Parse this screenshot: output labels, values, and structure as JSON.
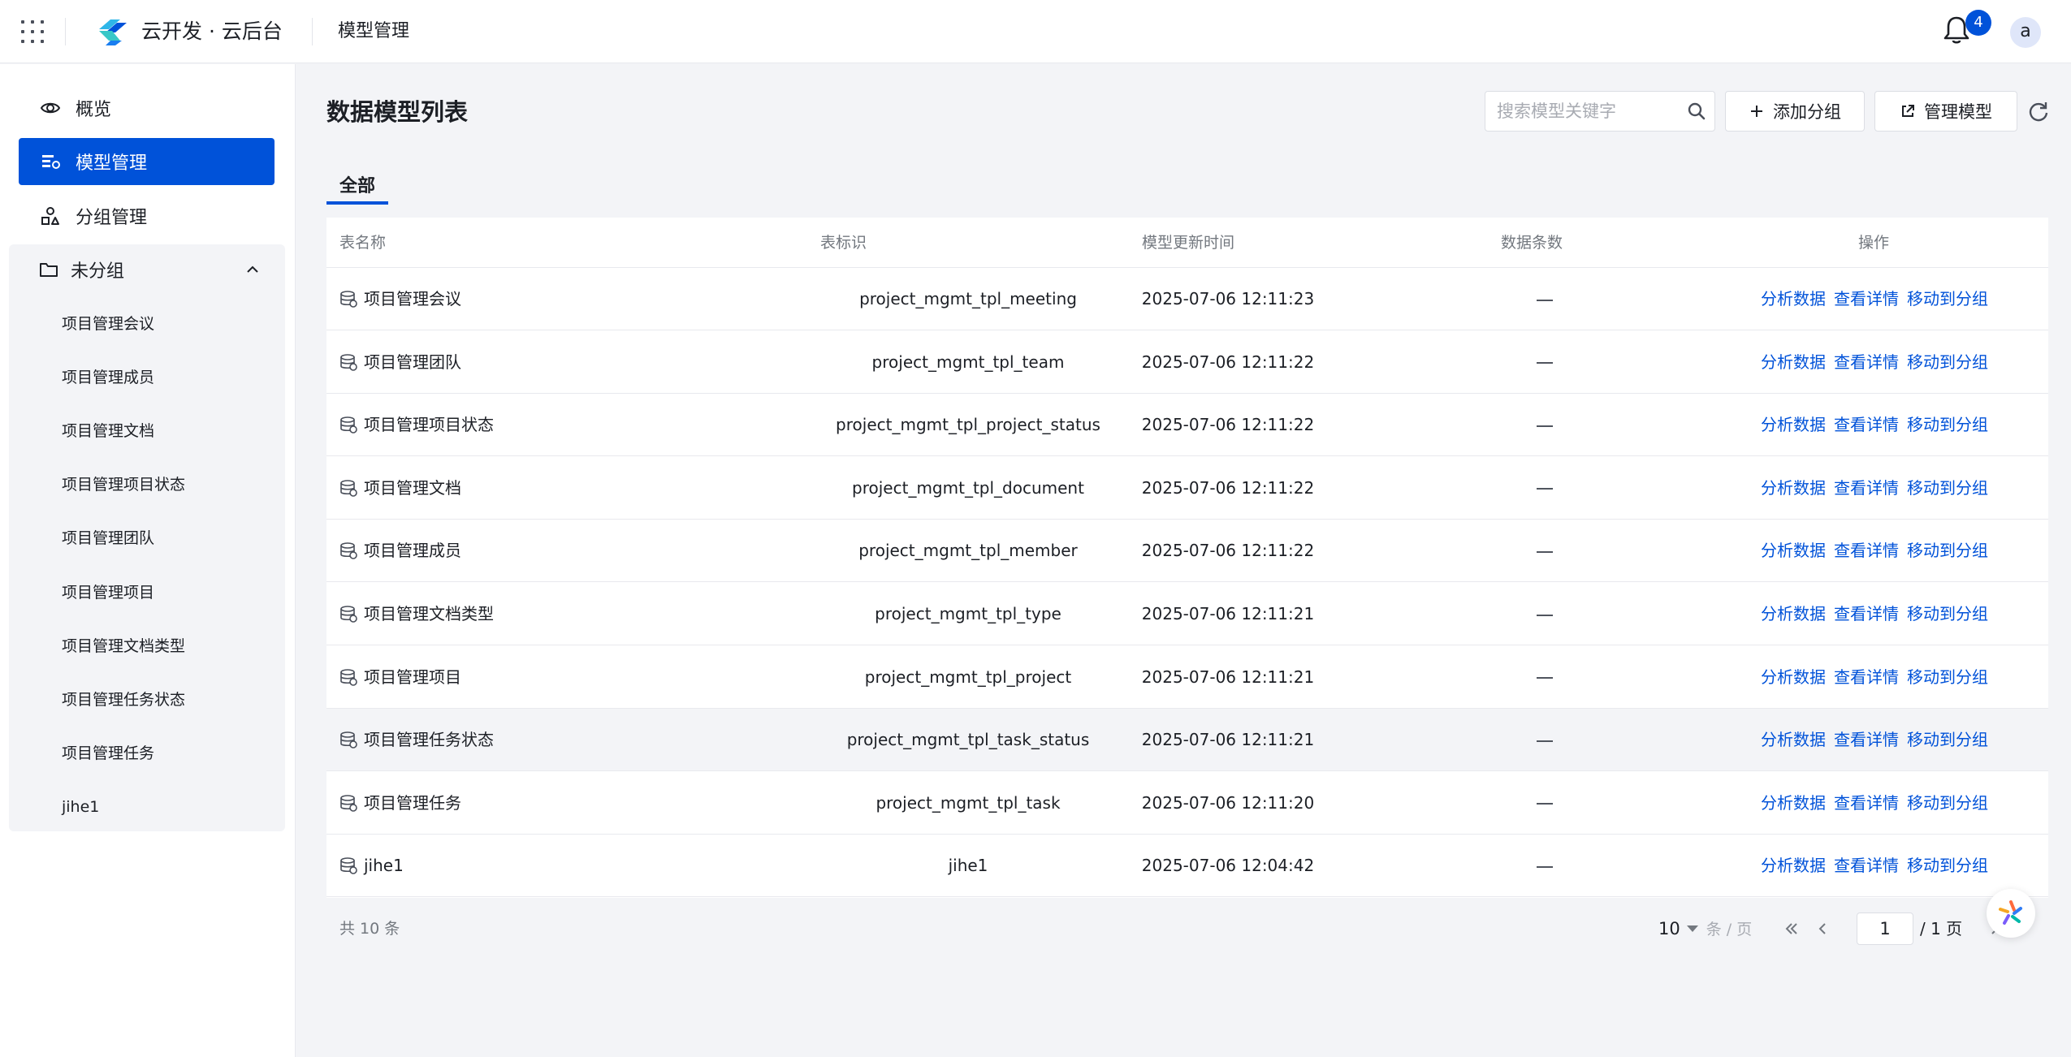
{
  "header": {
    "brand": "云开发 · 云后台",
    "breadcrumb": "模型管理",
    "notification_count": "4",
    "avatar_letter": "a"
  },
  "sidebar": {
    "items": [
      {
        "label": "概览",
        "icon": "eye-icon"
      },
      {
        "label": "模型管理",
        "icon": "model-list-icon",
        "active": true
      },
      {
        "label": "分组管理",
        "icon": "group-shapes-icon"
      }
    ],
    "group": {
      "label": "未分组",
      "icon": "folder-icon",
      "expanded": true,
      "children": [
        "项目管理会议",
        "项目管理成员",
        "项目管理文档",
        "项目管理项目状态",
        "项目管理团队",
        "项目管理项目",
        "项目管理文档类型",
        "项目管理任务状态",
        "项目管理任务",
        "jihe1"
      ]
    }
  },
  "main": {
    "title": "数据模型列表",
    "search_placeholder": "搜索模型关键字",
    "add_group_label": "添加分组",
    "manage_model_label": "管理模型",
    "tabs": [
      {
        "label": "全部",
        "active": true
      }
    ]
  },
  "table": {
    "columns": [
      "表名称",
      "表标识",
      "模型更新时间",
      "数据条数",
      "操作"
    ],
    "actions": [
      "分析数据",
      "查看详情",
      "移动到分组"
    ],
    "rows": [
      {
        "name": "项目管理会议",
        "id": "project_mgmt_tpl_meeting",
        "updated": "2025-07-06 12:11:23"
      },
      {
        "name": "项目管理团队",
        "id": "project_mgmt_tpl_team",
        "updated": "2025-07-06 12:11:22"
      },
      {
        "name": "项目管理项目状态",
        "id": "project_mgmt_tpl_project_status",
        "updated": "2025-07-06 12:11:22"
      },
      {
        "name": "项目管理文档",
        "id": "project_mgmt_tpl_document",
        "updated": "2025-07-06 12:11:22"
      },
      {
        "name": "项目管理成员",
        "id": "project_mgmt_tpl_member",
        "updated": "2025-07-06 12:11:22"
      },
      {
        "name": "项目管理文档类型",
        "id": "project_mgmt_tpl_type",
        "updated": "2025-07-06 12:11:21"
      },
      {
        "name": "项目管理项目",
        "id": "project_mgmt_tpl_project",
        "updated": "2025-07-06 12:11:21"
      },
      {
        "name": "项目管理任务状态",
        "id": "project_mgmt_tpl_task_status",
        "updated": "2025-07-06 12:11:21",
        "highlighted": true
      },
      {
        "name": "项目管理任务",
        "id": "project_mgmt_tpl_task",
        "updated": "2025-07-06 12:11:20"
      },
      {
        "name": "jihe1",
        "id": "jihe1",
        "updated": "2025-07-06 12:04:42"
      }
    ]
  },
  "pagination": {
    "total": "共 10 条",
    "page_size": "10",
    "page_size_unit": "条 / 页",
    "current_page": "1",
    "total_pages": "/ 1 页"
  },
  "colors": {
    "primary": "#0052d9",
    "background": "#f3f4f7",
    "text": "#1c1f25",
    "muted": "#73787f"
  }
}
